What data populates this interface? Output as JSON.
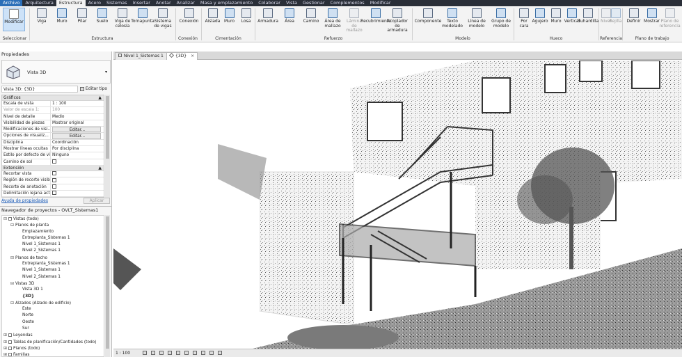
{
  "menu": [
    "Archivo",
    "Arquitectura",
    "Estructura",
    "Acero",
    "Sistemas",
    "Insertar",
    "Anotar",
    "Analizar",
    "Masa y emplazamiento",
    "Colaborar",
    "Vista",
    "Gestionar",
    "Complementos",
    "Modificar"
  ],
  "menu_active": "Estructura",
  "ribbon": {
    "select": {
      "modify": "Modificar",
      "group": "Seleccionar"
    },
    "estructura": {
      "items": [
        "Viga",
        "Muro",
        "Pilar",
        "Suelo",
        "Viga de celosía",
        "Tornapunta",
        "Sistema de vigas"
      ],
      "group": "Estructura"
    },
    "conexion": {
      "items": [
        "Conexión"
      ],
      "group": "Conexión"
    },
    "cimentacion": {
      "items": [
        "Aislada",
        "Muro",
        "Losa"
      ],
      "group": "Cimentación"
    },
    "refuerzo": {
      "items": [
        "Armadura",
        "Área",
        "Camino",
        "Área de mallazo",
        "Lámina de mallazo",
        "Recubrimiento",
        "Acoplador de armadura"
      ],
      "group": "Refuerzo"
    },
    "modelo": {
      "items": [
        "Componente",
        "Texto modelado",
        "Línea de modelo",
        "Grupo de modelo"
      ],
      "group": "Modelo"
    },
    "hueco": {
      "items": [
        "Por cara",
        "Agujero",
        "Muro",
        "Vertical",
        "Buhardilla"
      ],
      "group": "Hueco"
    },
    "referencia": {
      "items": [
        "Nivel",
        "Rejilla"
      ],
      "group": "Referencia"
    },
    "plano": {
      "items": [
        "Definir",
        "Mostrar",
        "Plano de referencia"
      ],
      "group": "Plano de trabajo"
    }
  },
  "view_tabs": [
    {
      "label": "Nivel 1_Sistemas 1",
      "close": "×"
    },
    {
      "label": "{3D}",
      "close": "×"
    }
  ],
  "properties": {
    "title": "Propiedades",
    "type_name": "Vista 3D",
    "dropdown": "▾",
    "view_select": "Vista 3D: {3D}",
    "edit_type": "Editar tipo",
    "sections": {
      "graficos": "Gráficos",
      "extension": "Extensión"
    },
    "rows_graficos": [
      {
        "k": "Escala de vista",
        "v": "1 : 100"
      },
      {
        "k": "Valor de escala    1:",
        "v": "100",
        "gray": true
      },
      {
        "k": "Nivel de detalle",
        "v": "Medio"
      },
      {
        "k": "Visibilidad de piezas",
        "v": "Mostrar original"
      },
      {
        "k": "Modificaciones de visi...",
        "v": "Editar...",
        "btn": true
      },
      {
        "k": "Opciones de visualiz...",
        "v": "Editar...",
        "btn": true
      },
      {
        "k": "Disciplina",
        "v": "Coordinación"
      },
      {
        "k": "Mostrar líneas ocultas",
        "v": "Por disciplina"
      },
      {
        "k": "Estilo por defecto de vi...",
        "v": "Ninguno"
      },
      {
        "k": "Camino de sol",
        "v": "",
        "cb": true
      }
    ],
    "rows_extension": [
      {
        "k": "Recortar vista",
        "v": "",
        "cb": true
      },
      {
        "k": "Región de recorte visible",
        "v": "",
        "cb": true
      },
      {
        "k": "Recorte de anotación",
        "v": "",
        "cb": true
      },
      {
        "k": "Delimitación lejana act...",
        "v": "",
        "cb": true
      }
    ],
    "help": "Ayuda de propiedades",
    "apply": "Aplicar"
  },
  "browser": {
    "title": "Navegador de proyectos - OVLT_Sistemas1",
    "nodes": [
      {
        "label": "Vistas (todo)",
        "lvl": 0,
        "tg": "⊟",
        "icon": true
      },
      {
        "label": "Planos de planta",
        "lvl": 1,
        "tg": "⊟"
      },
      {
        "label": "Emplazamiento",
        "lvl": 2,
        "tg": ""
      },
      {
        "label": "Entreplanta_Sistemas 1",
        "lvl": 2,
        "tg": ""
      },
      {
        "label": "Nivel 1_Sistemas 1",
        "lvl": 2,
        "tg": ""
      },
      {
        "label": "Nivel 2_Sistemas 1",
        "lvl": 2,
        "tg": ""
      },
      {
        "label": "Planos de techo",
        "lvl": 1,
        "tg": "⊟"
      },
      {
        "label": "Entreplanta_Sistemas 1",
        "lvl": 2,
        "tg": ""
      },
      {
        "label": "Nivel 1_Sistemas 1",
        "lvl": 2,
        "tg": ""
      },
      {
        "label": "Nivel 2_Sistemas 1",
        "lvl": 2,
        "tg": ""
      },
      {
        "label": "Vistas 3D",
        "lvl": 1,
        "tg": "⊟"
      },
      {
        "label": "Vista 3D 1",
        "lvl": 2,
        "tg": ""
      },
      {
        "label": "{3D}",
        "lvl": 2,
        "tg": "",
        "bold": true
      },
      {
        "label": "Alzados (Alzado de edificio)",
        "lvl": 1,
        "tg": "⊟"
      },
      {
        "label": "Este",
        "lvl": 2,
        "tg": ""
      },
      {
        "label": "Norte",
        "lvl": 2,
        "tg": ""
      },
      {
        "label": "Oeste",
        "lvl": 2,
        "tg": ""
      },
      {
        "label": "Sur",
        "lvl": 2,
        "tg": ""
      },
      {
        "label": "Leyendas",
        "lvl": 0,
        "tg": "⊞",
        "icon": true
      },
      {
        "label": "Tablas de planificación/Cantidades (todo)",
        "lvl": 0,
        "tg": "⊞",
        "icon": true
      },
      {
        "label": "Planos (todo)",
        "lvl": 0,
        "tg": "⊞",
        "icon": true
      },
      {
        "label": "Familias",
        "lvl": 0,
        "tg": "⊞",
        "icon": true
      }
    ]
  },
  "viewbar": {
    "scale": "1 : 100"
  },
  "colors": {
    "menubar": "#2a2f38",
    "accent": "#2b6fb8",
    "point_cloud": "#6e6e6e"
  }
}
